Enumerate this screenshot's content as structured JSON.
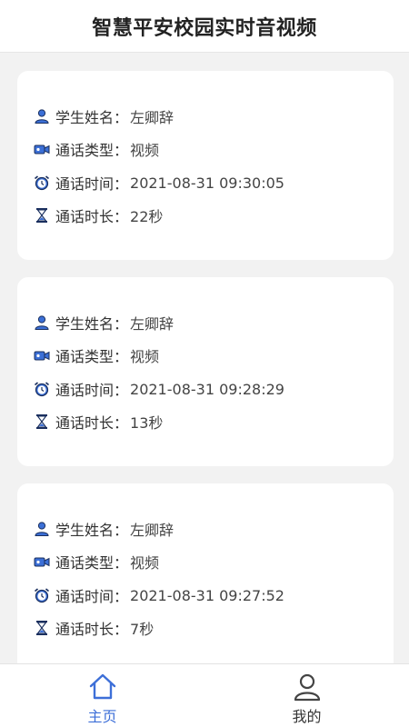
{
  "header": {
    "title": "智慧平安校园实时音视频"
  },
  "labels": {
    "student_name": "学生姓名：",
    "call_type": "通话类型：",
    "call_time": "通话时间：",
    "call_duration": "通话时长："
  },
  "records": [
    {
      "student_name": "左卿辞",
      "call_type": "视频",
      "call_time": "2021-08-31 09:30:05",
      "call_duration": "22秒"
    },
    {
      "student_name": "左卿辞",
      "call_type": "视频",
      "call_time": "2021-08-31 09:28:29",
      "call_duration": "13秒"
    },
    {
      "student_name": "左卿辞",
      "call_type": "视频",
      "call_time": "2021-08-31 09:27:52",
      "call_duration": "7秒"
    }
  ],
  "icons": {
    "student": "person-icon",
    "type": "video-camera-icon",
    "time": "alarm-clock-icon",
    "duration": "hourglass-icon"
  },
  "tabbar": {
    "home_label": "主页",
    "mine_label": "我的",
    "active_color": "#3d6fd8"
  }
}
